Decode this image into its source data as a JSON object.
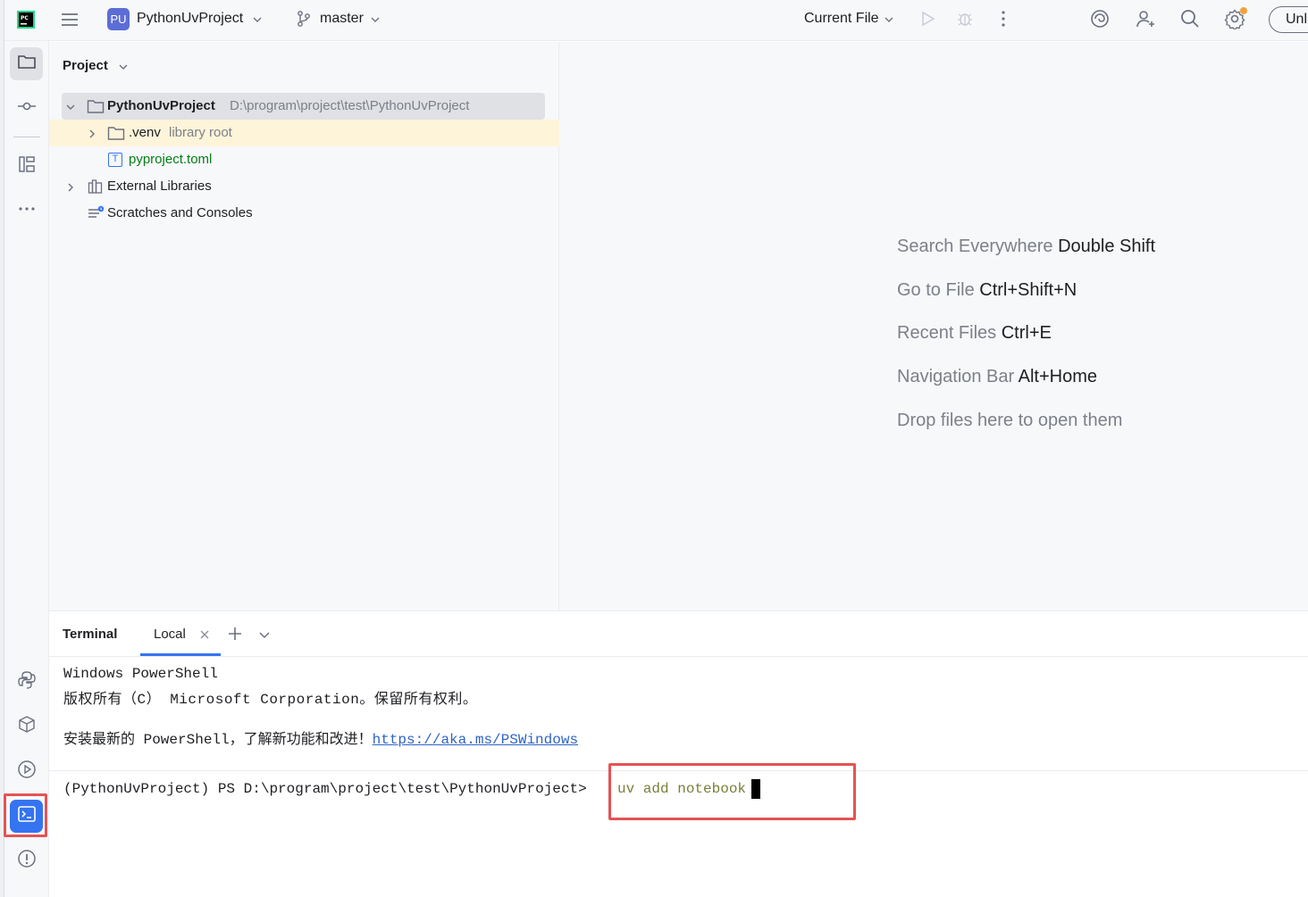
{
  "topbar": {
    "project_badge": "PU",
    "project_name": "PythonUvProject",
    "branch": "master",
    "run_config": "Current File",
    "unlock_label": "Unl"
  },
  "project_panel": {
    "title": "Project",
    "tree": [
      {
        "name": "PythonUvProject",
        "hint": "D:\\program\\project\\test\\PythonUvProject"
      },
      {
        "name": ".venv",
        "hint": "library root"
      },
      {
        "name": "pyproject.toml",
        "hint": ""
      },
      {
        "name": "External Libraries",
        "hint": ""
      },
      {
        "name": "Scratches and Consoles",
        "hint": ""
      }
    ]
  },
  "editor": {
    "hints": [
      {
        "label": "Search Everywhere",
        "shortcut": "Double Shift"
      },
      {
        "label": "Go to File",
        "shortcut": "Ctrl+Shift+N"
      },
      {
        "label": "Recent Files",
        "shortcut": "Ctrl+E"
      },
      {
        "label": "Navigation Bar",
        "shortcut": "Alt+Home"
      },
      {
        "label": "Drop files here to open them",
        "shortcut": ""
      }
    ]
  },
  "terminal": {
    "title": "Terminal",
    "tab": "Local",
    "lines": [
      "Windows PowerShell",
      "版权所有（C） Microsoft Corporation。保留所有权利。",
      "安装最新的 PowerShell，了解新功能和改进！"
    ],
    "link": "https://aka.ms/PSWindows",
    "prompt": "(PythonUvProject) PS D:\\program\\project\\test\\PythonUvProject>",
    "command": "uv add notebook"
  },
  "colors": {
    "accent": "#3574f0",
    "highlight": "#e55353",
    "green_file": "#067d17"
  }
}
